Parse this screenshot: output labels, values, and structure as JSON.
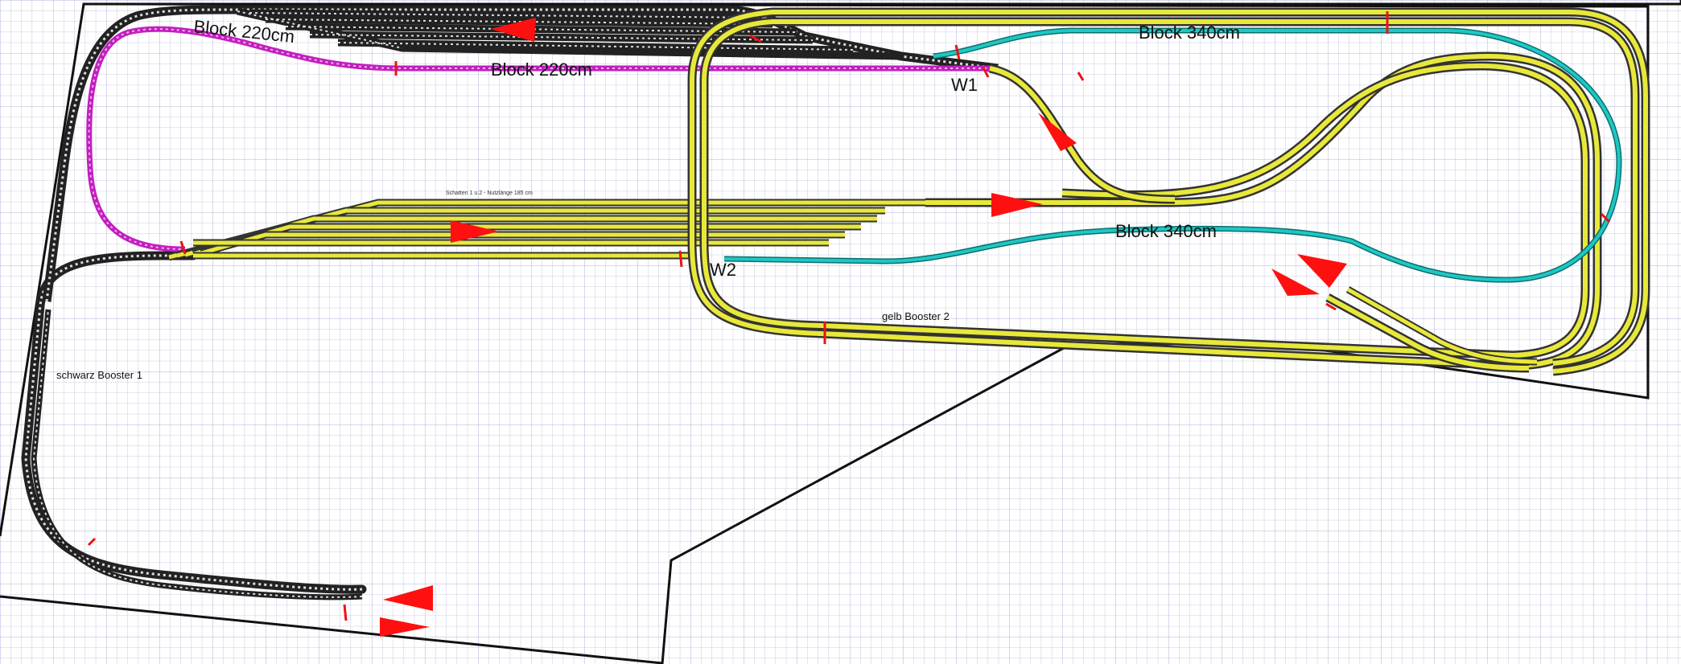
{
  "colors": {
    "grid": "#b9bbdc",
    "grid_bold": "#9ea1cf",
    "outline": "#111111",
    "track_black": "#222222",
    "track_yellow": "#e8e83a",
    "track_cyan": "#1aa7a5",
    "track_magenta": "#c21fbf",
    "sleeper_light": "#dddddd",
    "signal_red": "#ee1111",
    "arrow_red": "#ff1010"
  },
  "labels": {
    "block_220_top_left": "Block 220cm",
    "block_220_center": "Block 220cm",
    "block_340_top": "Block 340cm",
    "block_340_middle": "Block 340cm",
    "switch_w1": "W1",
    "switch_w2": "W2",
    "booster_black": "schwarz Booster 1",
    "booster_yellow": "gelb Booster 2",
    "shadow_station": "Schatten 1 u.2 - Nutzlänge 185 cm"
  }
}
